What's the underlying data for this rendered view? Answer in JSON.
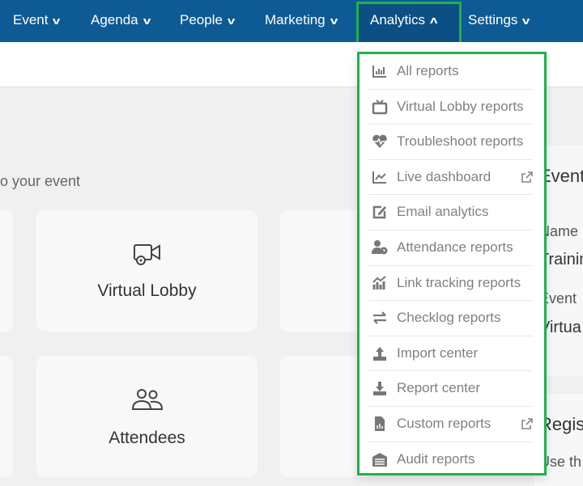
{
  "nav": {
    "items": [
      {
        "label": "Event",
        "chevron": "chevron-down-icon"
      },
      {
        "label": "Agenda",
        "chevron": "chevron-down-icon"
      },
      {
        "label": "People",
        "chevron": "chevron-down-icon"
      },
      {
        "label": "Marketing",
        "chevron": "chevron-down-icon"
      },
      {
        "label": "Analytics",
        "chevron": "chevron-up-icon",
        "active": true
      },
      {
        "label": "Settings",
        "chevron": "chevron-down-icon"
      }
    ]
  },
  "main": {
    "hint": "o your event",
    "cards": [
      {
        "label": "Virtual Lobby",
        "icon": "video-gear-icon"
      },
      {
        "label": "Attendees",
        "icon": "users-icon"
      }
    ],
    "right_panel": {
      "title": "Event",
      "name_label": "Name",
      "name_value": "Trainin",
      "event_label": "Event",
      "event_value": "Virtua",
      "section2_title": "Regis",
      "section2_text": "Use th"
    }
  },
  "dropdown": {
    "items": [
      {
        "label": "All reports",
        "icon": "bar-chart-icon"
      },
      {
        "label": "Virtual Lobby reports",
        "icon": "tv-icon"
      },
      {
        "label": "Troubleshoot reports",
        "icon": "heartbeat-icon"
      },
      {
        "label": "Live dashboard",
        "icon": "line-chart-icon",
        "external": true
      },
      {
        "label": "Email analytics",
        "icon": "edit-icon"
      },
      {
        "label": "Attendance reports",
        "icon": "user-clock-icon"
      },
      {
        "label": "Link tracking reports",
        "icon": "chart-trend-icon"
      },
      {
        "label": "Checklog reports",
        "icon": "exchange-icon"
      },
      {
        "label": "Import center",
        "icon": "upload-icon"
      },
      {
        "label": "Report center",
        "icon": "download-icon"
      },
      {
        "label": "Custom reports",
        "icon": "file-chart-icon",
        "external": true
      },
      {
        "label": "Audit reports",
        "icon": "warehouse-icon"
      }
    ]
  },
  "colors": {
    "nav": "#0e5a94",
    "highlight": "#1db34a"
  }
}
